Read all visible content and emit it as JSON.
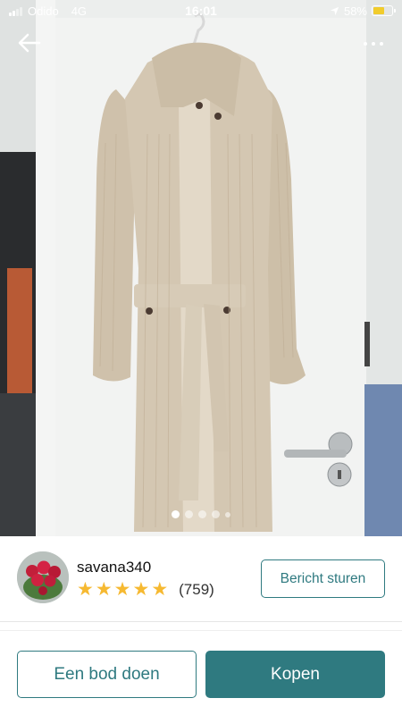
{
  "status_bar": {
    "carrier": "Odido",
    "network": "4G",
    "time": "16:01",
    "battery": "58%",
    "battery_level": 0.58,
    "location_icon": "location-arrow-icon"
  },
  "nav": {
    "back_icon": "back-arrow-icon",
    "more_icon": "more-dots-icon"
  },
  "gallery": {
    "image_count": 5,
    "active_index": 0
  },
  "seller": {
    "username": "savana340",
    "rating_stars": 5,
    "review_count": "(759)",
    "message_button": "Bericht sturen"
  },
  "actions": {
    "offer_button": "Een bod doen",
    "buy_button": "Kopen"
  },
  "colors": {
    "accent": "#2f7a80",
    "star": "#f6b931",
    "battery": "#f1cc2c"
  }
}
